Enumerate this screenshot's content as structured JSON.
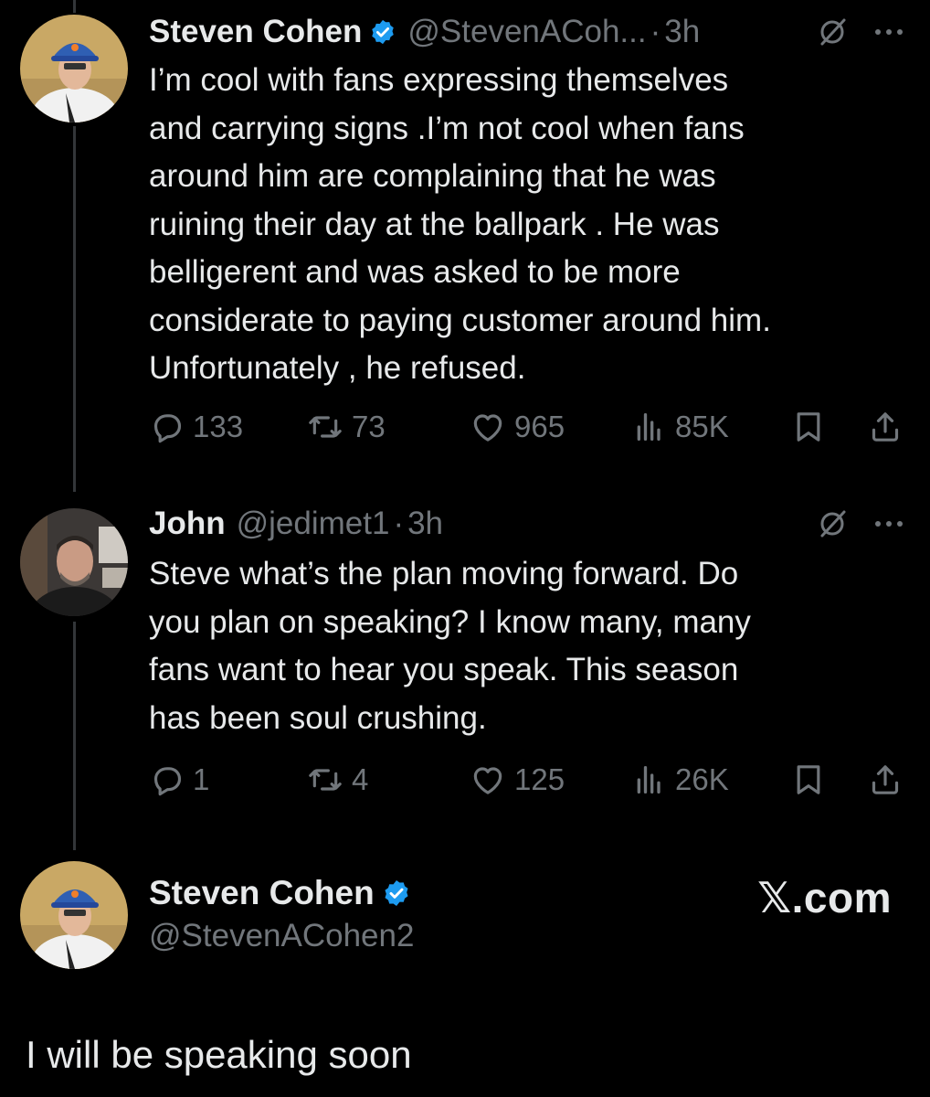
{
  "tweets": [
    {
      "display_name": "Steven Cohen",
      "handle": "@StevenACoh...",
      "dot": "·",
      "time": "3h",
      "text": "I’m cool with fans expressing themselves\nand carrying signs .I’m not cool when fans\naround him are complaining that he was\nruining their day at the ballpark . He was\nbelligerent and was asked to be more\nconsiderate to paying customer around him.\nUnfortunately , he refused.",
      "replies": "133",
      "reposts": "73",
      "likes": "965",
      "views": "85K"
    },
    {
      "display_name": "John",
      "handle": "@jedimet1",
      "dot": "·",
      "time": "3h",
      "text": "Steve what’s the plan moving forward. Do\nyou plan on speaking? I know many, many\nfans want to hear you speak. This season\nhas been soul crushing.",
      "replies": "1",
      "reposts": "4",
      "likes": "125",
      "views": "26K"
    }
  ],
  "profile_card": {
    "display_name": "Steven Cohen",
    "handle": "@StevenACohen2",
    "brand": "𝕏.com"
  },
  "quote": "I will be speaking soon",
  "icons": {
    "verified": "verified-badge-icon",
    "grok": "grok-icon",
    "more": "more-icon",
    "reply": "reply-icon",
    "repost": "repost-icon",
    "like": "like-icon",
    "views": "views-icon",
    "bookmark": "bookmark-icon",
    "share": "share-icon"
  },
  "colors": {
    "background": "#000000",
    "text": "#e7e9ea",
    "muted": "#71767b",
    "verified": "#1d9bf0",
    "thread_line": "#333639"
  }
}
